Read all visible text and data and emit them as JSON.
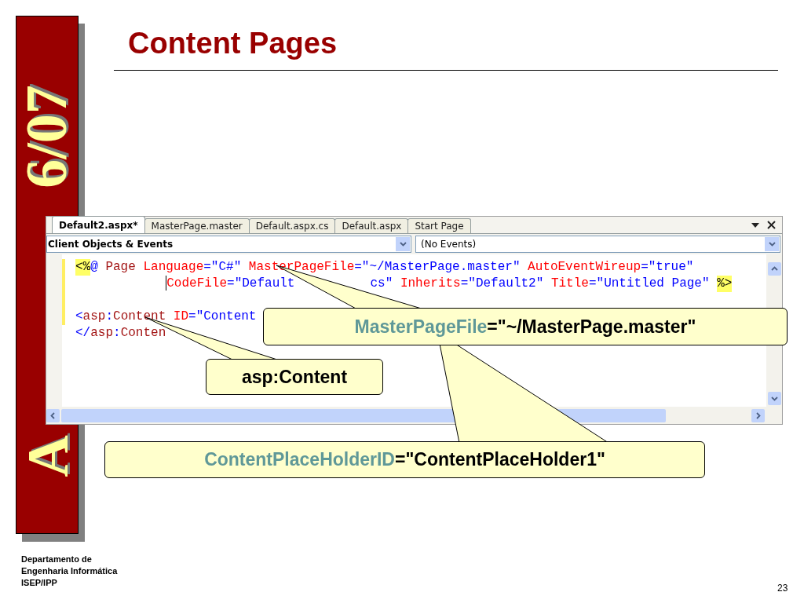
{
  "banner": {
    "texts": [
      "6/07",
      "A"
    ]
  },
  "title": "Content Pages",
  "editor": {
    "tabs": [
      {
        "label": "Default2.aspx*",
        "selected": true
      },
      {
        "label": "MasterPage.master",
        "selected": false
      },
      {
        "label": "Default.aspx.cs",
        "selected": false
      },
      {
        "label": "Default.aspx",
        "selected": false
      },
      {
        "label": "Start Page",
        "selected": false
      }
    ],
    "object_dropdown": "Client Objects & Events",
    "event_dropdown": "(No Events)",
    "code_lines": [
      {
        "changed": true,
        "tokens": [
          {
            "text": "<%",
            "kind": "delim"
          },
          {
            "text": "@ ",
            "kind": "punct"
          },
          {
            "text": "Page ",
            "kind": "element"
          },
          {
            "text": "Language",
            "kind": "attr"
          },
          {
            "text": "=\"C#\" ",
            "kind": "value"
          },
          {
            "text": "MasterPageFile",
            "kind": "attr"
          },
          {
            "text": "=\"~/MasterPage.master\" ",
            "kind": "value"
          },
          {
            "text": "AutoEventWireup",
            "kind": "attr"
          },
          {
            "text": "=\"true\"",
            "kind": "value"
          }
        ]
      },
      {
        "changed": true,
        "caret": true,
        "indent": true,
        "tokens": [
          {
            "text": "CodeFile",
            "kind": "attr"
          },
          {
            "text": "=\"Default",
            "kind": "value",
            "covered_after": true
          },
          {
            "text": "cs\" ",
            "kind": "value"
          },
          {
            "text": "Inherits",
            "kind": "attr"
          },
          {
            "text": "=\"Default2\" ",
            "kind": "value"
          },
          {
            "text": "Title",
            "kind": "attr"
          },
          {
            "text": "=\"Untitled Page\" ",
            "kind": "value"
          },
          {
            "text": "%>",
            "kind": "delim"
          }
        ]
      },
      {
        "changed": true
      },
      {
        "changed": true,
        "tokens": [
          {
            "text": "<",
            "kind": "punct"
          },
          {
            "text": "asp",
            "kind": "element"
          },
          {
            "text": ":",
            "kind": "punct"
          },
          {
            "text": "Content ",
            "kind": "element"
          },
          {
            "text": "ID",
            "kind": "attr"
          },
          {
            "text": "=\"Content",
            "kind": "value"
          }
        ]
      },
      {
        "changed": false,
        "tokens": [
          {
            "text": "</",
            "kind": "punct"
          },
          {
            "text": "asp",
            "kind": "element"
          },
          {
            "text": ":",
            "kind": "punct"
          },
          {
            "text": "Conten",
            "kind": "element"
          }
        ]
      }
    ]
  },
  "callouts": [
    {
      "parts": [
        {
          "text": "MasterPageFile",
          "kind": "name"
        },
        {
          "text": "=\"~/MasterPage.master\"",
          "kind": "value"
        }
      ]
    },
    {
      "parts": [
        {
          "text": "asp:Content",
          "kind": "value"
        }
      ]
    },
    {
      "parts": [
        {
          "text": "ContentPlaceHolderID",
          "kind": "name"
        },
        {
          "text": "=\"ContentPlaceHolder1\"",
          "kind": "value"
        }
      ]
    }
  ],
  "footer": [
    "Departamento de",
    "Engenharia Informática",
    "ISEP/IPP"
  ],
  "page_number": "23"
}
